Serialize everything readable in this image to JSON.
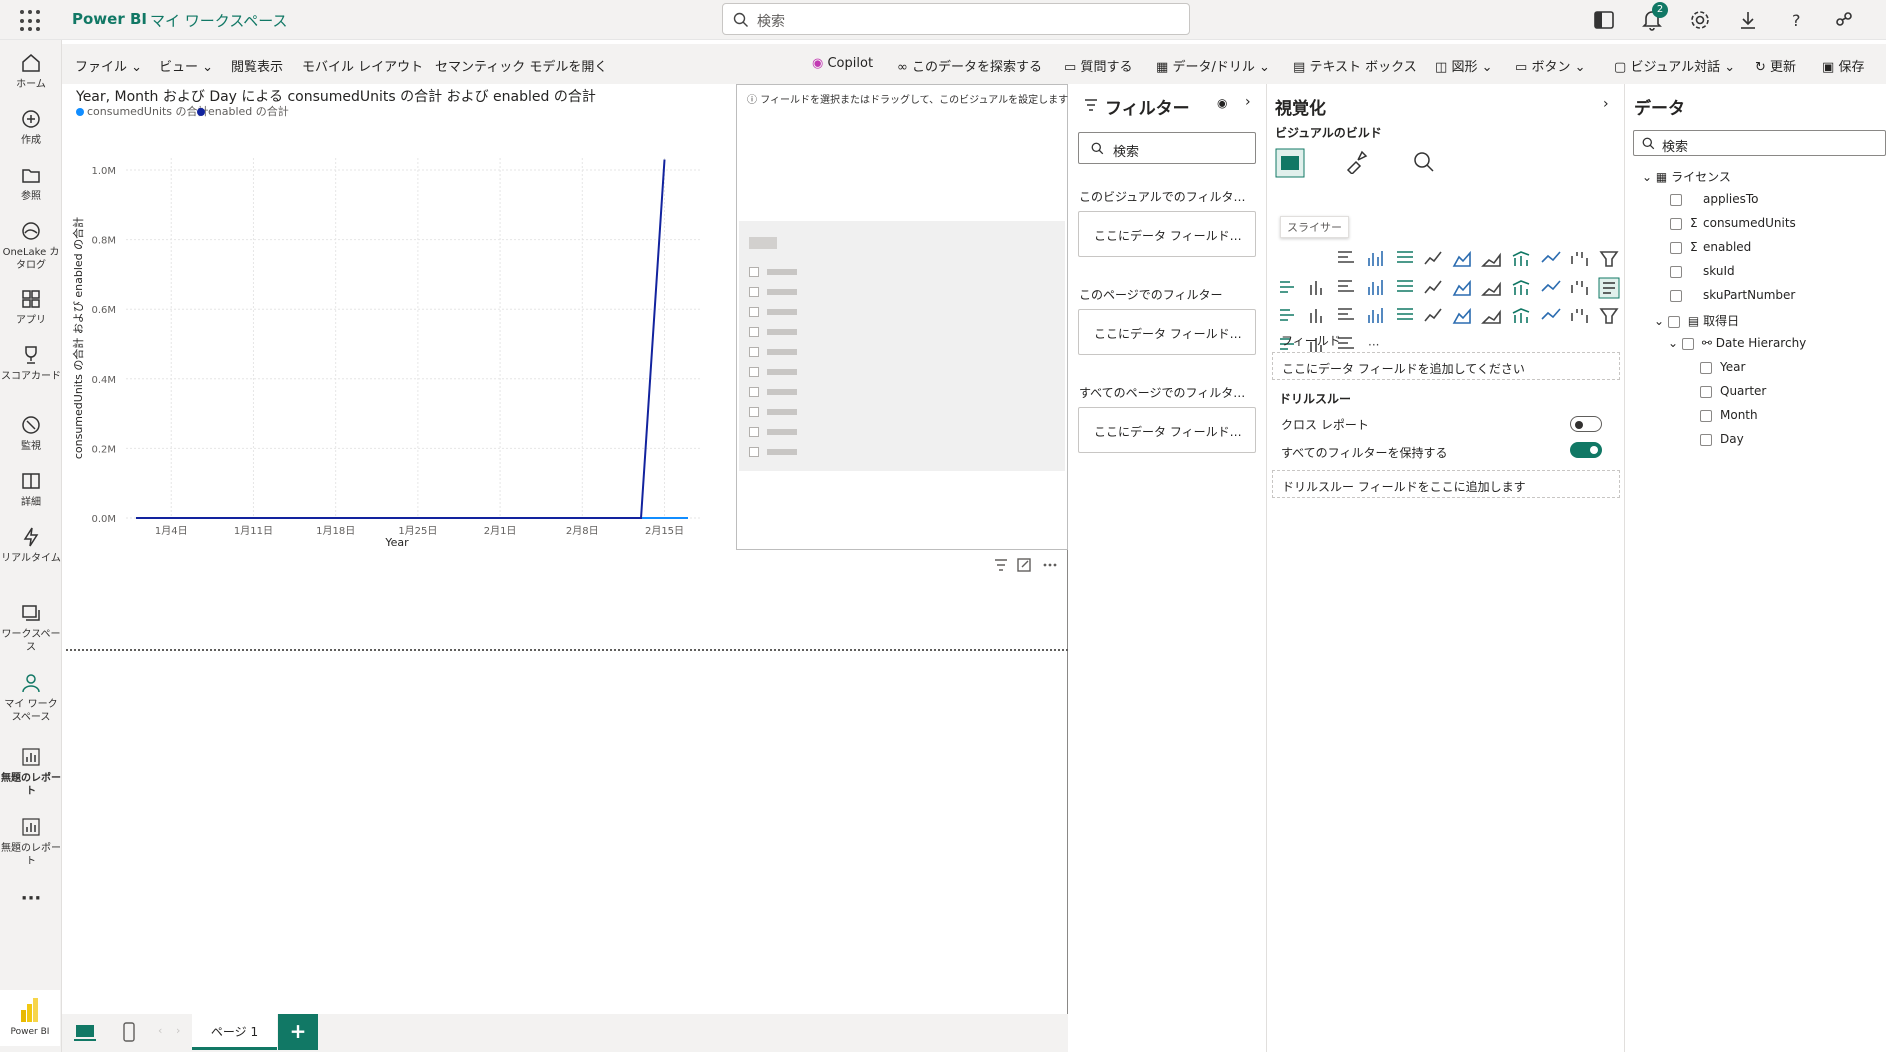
{
  "app": {
    "brand": "Power BI",
    "workspace": "マイ ワークスペース",
    "search_placeholder": "検索",
    "notif_count": "2",
    "logo_label": "Power BI"
  },
  "ribbon": {
    "file": "ファイル",
    "view": "ビュー",
    "reading": "閲覧表示",
    "mobile": "モバイル レイアウト",
    "semantic": "セマンティック モデルを開く",
    "copilot": "Copilot",
    "explore": "このデータを探索する",
    "ask": "質問する",
    "data_drill": "データ/ドリル",
    "textbox": "テキスト ボックス",
    "shapes": "図形",
    "buttons": "ボタン",
    "visual_dialog": "ビジュアル対話",
    "refresh": "更新",
    "save": "保存"
  },
  "nav": [
    "ホーム",
    "作成",
    "参照",
    "OneLake カタログ",
    "アプリ",
    "スコアカード",
    "監視",
    "詳細",
    "リアルタイム",
    "ワークスペース",
    "マイ ワークスペース",
    "無題のレポート",
    "無題のレポート"
  ],
  "chart": {
    "title": "Year, Month および Day による consumedUnits の合計 および enabled の合計",
    "legend1": "consumedUnits の合計",
    "legend2": "enabled の合計",
    "ylabel": "consumedUnits の合計 および enabled の合計",
    "xlabel": "Year"
  },
  "chart_data": {
    "type": "line",
    "title": "Year, Month および Day による consumedUnits の合計 および enabled の合計",
    "xlabel": "Year",
    "ylabel": "consumedUnits の合計 および enabled の合計",
    "yticks": [
      "0.0M",
      "0.2M",
      "0.4M",
      "0.6M",
      "0.8M",
      "1.0M"
    ],
    "ylim": [
      0,
      1050000
    ],
    "xticks": [
      "1月4日",
      "1月11日",
      "1月18日",
      "1月25日",
      "2月1日",
      "2月8日",
      "2月15日"
    ],
    "series": [
      {
        "name": "consumedUnits の合計",
        "color": "#118DFF",
        "values": [
          [
            0,
            0
          ],
          [
            47,
            0
          ]
        ]
      },
      {
        "name": "enabled の合計",
        "color": "#12239E",
        "values": [
          [
            0,
            0
          ],
          [
            43,
            0
          ],
          [
            45,
            1030000
          ]
        ]
      }
    ],
    "legend": "top-left",
    "grid": true
  },
  "select_msg": "フィールドを選択またはドラッグして、このビジュアルを設定します",
  "filters": {
    "title": "フィルター",
    "search": "検索",
    "sec_visual": "このビジュアルでのフィルタ…",
    "sec_page": "このページでのフィルター",
    "sec_all": "すべてのページでのフィルタ…",
    "drop": "ここにデータ フィールド…"
  },
  "viz": {
    "title": "視覚化",
    "build": "ビジュアルのビルド",
    "tooltip": "スライサー",
    "fields": "フィールド",
    "fields_drop": "ここにデータ フィールドを追加してください",
    "drill": "ドリルスルー",
    "cross": "クロス レポート",
    "keep": "すべてのフィルターを保持する",
    "drill_drop": "ドリルスルー フィールドをここに追加します"
  },
  "data": {
    "title": "データ",
    "search": "検索",
    "table": "ライセンス",
    "f1": "appliesTo",
    "f2": "consumedUnits",
    "f3": "enabled",
    "f4": "skuId",
    "f5": "skuPartNumber",
    "table2": "取得日",
    "hier": "Date Hierarchy",
    "h1": "Year",
    "h2": "Quarter",
    "h3": "Month",
    "h4": "Day"
  },
  "pages": {
    "page1": "ページ 1"
  }
}
